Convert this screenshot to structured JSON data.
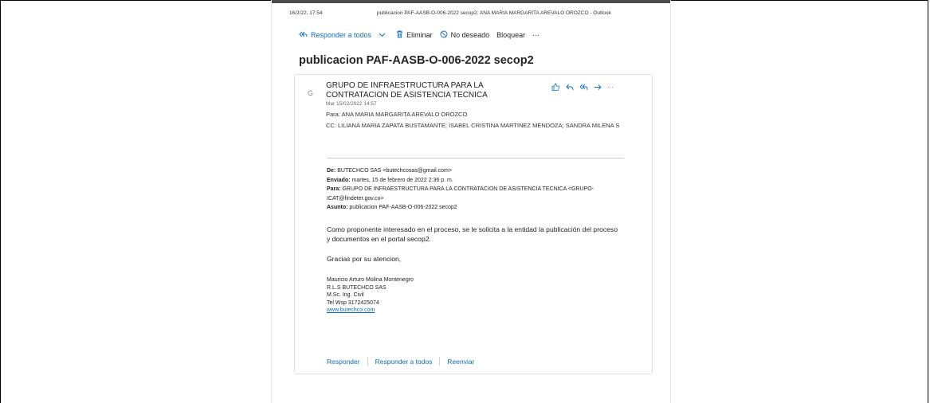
{
  "print_header": {
    "date": "16/2/22, 17:54",
    "title": "publicacion PAF-AASB-O-006-2022 secop2: ANA MARIA MARGARITA AREVALO OROZCO - Outlook"
  },
  "toolbar": {
    "reply_all": "Responder a todos",
    "delete": "Eliminar",
    "junk": "No deseado",
    "block": "Bloquear",
    "more": "···"
  },
  "email": {
    "subject": "publicacion PAF-AASB-O-006-2022 secop2",
    "avatar_letter": "G",
    "sender": "GRUPO DE INFRAESTRUCTURA PARA LA CONTRATACION DE ASISTENCIA TECNICA",
    "date": "Mar 15/02/2022 14:57",
    "to_label": "Para:",
    "to": "ANA MARIA MARGARITA AREVALO OROZCO",
    "cc_label": "CC:",
    "cc": "LILIANA MARIA ZAPATA BUSTAMANTE; ISABEL CRISTINA MARTINEZ MENDOZA; SANDRA MILENA S",
    "actions_more": "···"
  },
  "forwarded": {
    "from_label": "De:",
    "from": "BUTECHCO SAS <butechcosas@gmail.com>",
    "sent_label": "Enviado:",
    "sent": "martes, 15 de febrero de 2022 2:36 p. m.",
    "to_label": "Para:",
    "to": "GRUPO DE INFRAESTRUCTURA PARA LA CONTRATACION DE ASISTENCIA TECNICA <GRUPO-ICAT@findeter.gov.co>",
    "subject_label": "Asunto:",
    "subject": "publicacion PAF-AASB-O-006-2022 secop2"
  },
  "body": {
    "paragraph1": "Como proponente interesado en el proceso, se le solicita a la entidad la publicación del proceso y documentos en el portal secop2.",
    "paragraph2": "Gracias por su atencion,"
  },
  "signature": {
    "name": "Mauricio Arturo Molina Montenegro",
    "role": "R.L.S BUTECHCO SAS",
    "degree": "M.Sc. Ing. Civil",
    "phone": "Tel Wsp 3172425074",
    "website": "www.butechco.com"
  },
  "footer": {
    "reply": "Responder",
    "reply_all": "Responder a todos",
    "forward": "Reenviar"
  },
  "colors": {
    "accent": "#0f6cbd",
    "text": "#242424"
  }
}
